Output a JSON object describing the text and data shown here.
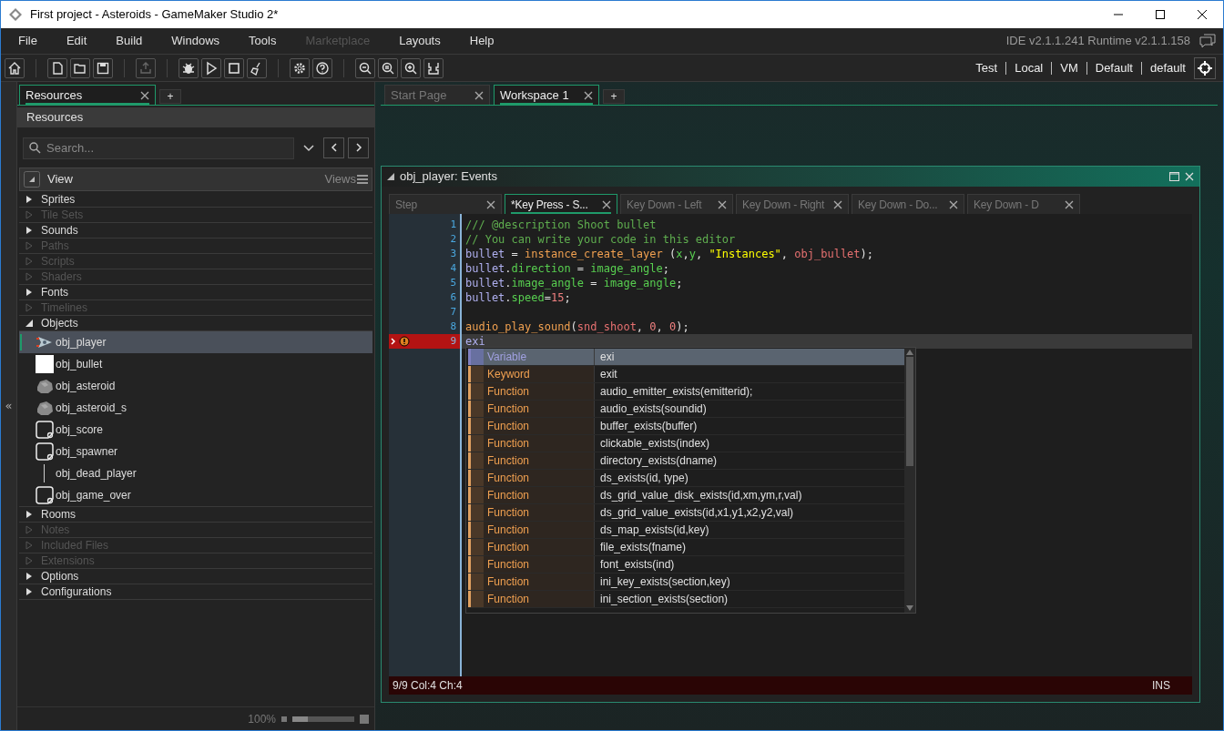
{
  "window": {
    "title": "First project - Asteroids - GameMaker Studio 2*"
  },
  "menu": [
    {
      "label": "File",
      "disabled": false
    },
    {
      "label": "Edit",
      "disabled": false
    },
    {
      "label": "Build",
      "disabled": false
    },
    {
      "label": "Windows",
      "disabled": false
    },
    {
      "label": "Tools",
      "disabled": false
    },
    {
      "label": "Marketplace",
      "disabled": true
    },
    {
      "label": "Layouts",
      "disabled": false
    },
    {
      "label": "Help",
      "disabled": false
    }
  ],
  "version": "IDE v2.1.1.241 Runtime v2.1.1.158",
  "sidebar_toggle": "«",
  "target": [
    "Test",
    "Local",
    "VM",
    "Default",
    "default"
  ],
  "left_panel": {
    "tabs": [
      {
        "label": "Resources",
        "selected": true
      }
    ],
    "add_tab": "+",
    "header": "Resources",
    "search": {
      "placeholder": "Search..."
    },
    "view_label": "View",
    "views_label": "Views",
    "tree": [
      {
        "label": "Sprites",
        "disabled": false,
        "expanded": false
      },
      {
        "label": "Tile Sets",
        "disabled": true,
        "expanded": false
      },
      {
        "label": "Sounds",
        "disabled": false,
        "expanded": false
      },
      {
        "label": "Paths",
        "disabled": true,
        "expanded": false
      },
      {
        "label": "Scripts",
        "disabled": true,
        "expanded": false
      },
      {
        "label": "Shaders",
        "disabled": true,
        "expanded": false
      },
      {
        "label": "Fonts",
        "disabled": false,
        "expanded": false
      },
      {
        "label": "Timelines",
        "disabled": true,
        "expanded": false
      },
      {
        "label": "Objects",
        "disabled": false,
        "expanded": true,
        "children": [
          {
            "label": "obj_player",
            "kind": "ship",
            "selected": true
          },
          {
            "label": "obj_bullet",
            "kind": "square",
            "selected": false
          },
          {
            "label": "obj_asteroid",
            "kind": "rock",
            "selected": false
          },
          {
            "label": "obj_asteroid_s",
            "kind": "rock",
            "selected": false
          },
          {
            "label": "obj_score",
            "kind": "blank",
            "selected": false
          },
          {
            "label": "obj_spawner",
            "kind": "blank",
            "selected": false
          },
          {
            "label": "obj_dead_player",
            "kind": "none",
            "selected": false
          },
          {
            "label": "obj_game_over",
            "kind": "blank",
            "selected": false
          }
        ]
      },
      {
        "label": "Rooms",
        "disabled": false,
        "expanded": false
      },
      {
        "label": "Notes",
        "disabled": true,
        "expanded": false
      },
      {
        "label": "Included Files",
        "disabled": true,
        "expanded": false
      },
      {
        "label": "Extensions",
        "disabled": true,
        "expanded": false
      },
      {
        "label": "Options",
        "disabled": false,
        "expanded": false
      },
      {
        "label": "Configurations",
        "disabled": false,
        "expanded": false
      }
    ],
    "zoom": {
      "reading": "100%",
      "level": 0.25
    }
  },
  "doc_tabs": [
    {
      "label": "Start Page",
      "selected": false
    },
    {
      "label": "Workspace 1",
      "selected": true
    }
  ],
  "add_tab": "+",
  "editor": {
    "title": "obj_player: Events",
    "tabs": [
      {
        "label": "Step",
        "selected": false
      },
      {
        "label": "*Key Press - S...",
        "selected": true
      },
      {
        "label": "Key Down - Left",
        "selected": false
      },
      {
        "label": "Key Down - Right",
        "selected": false
      },
      {
        "label": "Key Down - Do...",
        "selected": false
      },
      {
        "label": "Key Down - D",
        "selected": false
      }
    ],
    "lines": [
      {
        "number": "1",
        "error": false,
        "tokens": [
          {
            "text": "/// @description Shoot bullet",
            "kind": "comment"
          }
        ]
      },
      {
        "number": "2",
        "error": false,
        "tokens": [
          {
            "text": "// You can write your code in this editor",
            "kind": "comment"
          }
        ]
      },
      {
        "number": "3",
        "error": false,
        "tokens": [
          {
            "text": "bullet",
            "kind": "variable"
          },
          {
            "text": " = ",
            "kind": "plain"
          },
          {
            "text": "instance_create_layer",
            "kind": "function"
          },
          {
            "text": " (",
            "kind": "plain"
          },
          {
            "text": "x",
            "kind": "builtin"
          },
          {
            "text": ",",
            "kind": "plain"
          },
          {
            "text": "y",
            "kind": "builtin"
          },
          {
            "text": ", ",
            "kind": "plain"
          },
          {
            "text": "\"Instances\"",
            "kind": "string"
          },
          {
            "text": ", ",
            "kind": "plain"
          },
          {
            "text": "obj_bullet",
            "kind": "asset"
          },
          {
            "text": ");",
            "kind": "plain"
          }
        ]
      },
      {
        "number": "4",
        "error": false,
        "tokens": [
          {
            "text": "bullet",
            "kind": "variable"
          },
          {
            "text": ".",
            "kind": "plain"
          },
          {
            "text": "direction",
            "kind": "builtin"
          },
          {
            "text": " = ",
            "kind": "plain"
          },
          {
            "text": "image_angle",
            "kind": "builtin"
          },
          {
            "text": ";",
            "kind": "plain"
          }
        ]
      },
      {
        "number": "5",
        "error": false,
        "tokens": [
          {
            "text": "bullet",
            "kind": "variable"
          },
          {
            "text": ".",
            "kind": "plain"
          },
          {
            "text": "image_angle",
            "kind": "builtin"
          },
          {
            "text": " = ",
            "kind": "plain"
          },
          {
            "text": "image_angle",
            "kind": "builtin"
          },
          {
            "text": ";",
            "kind": "plain"
          }
        ]
      },
      {
        "number": "6",
        "error": false,
        "tokens": [
          {
            "text": "bullet",
            "kind": "variable"
          },
          {
            "text": ".",
            "kind": "plain"
          },
          {
            "text": "speed",
            "kind": "builtin"
          },
          {
            "text": "=",
            "kind": "plain"
          },
          {
            "text": "15",
            "kind": "number"
          },
          {
            "text": ";",
            "kind": "plain"
          }
        ]
      },
      {
        "number": "7",
        "error": false
      },
      {
        "number": "8",
        "error": false,
        "tokens": [
          {
            "text": "audio_play_sound",
            "kind": "function"
          },
          {
            "text": "(",
            "kind": "plain"
          },
          {
            "text": "snd_shoot",
            "kind": "asset"
          },
          {
            "text": ", ",
            "kind": "plain"
          },
          {
            "text": "0",
            "kind": "number"
          },
          {
            "text": ", ",
            "kind": "plain"
          },
          {
            "text": "0",
            "kind": "number"
          },
          {
            "text": ");",
            "kind": "plain"
          }
        ]
      },
      {
        "number": "9",
        "error": true,
        "tokens": [
          {
            "text": "exi",
            "kind": "variable"
          }
        ]
      }
    ],
    "completions": [
      {
        "type": "Variable",
        "text": "exi",
        "kind": "variable",
        "selected": true
      },
      {
        "type": "Keyword",
        "text": "exit",
        "kind": "keyword",
        "selected": false
      },
      {
        "type": "Function",
        "text": "audio_emitter_exists(emitterid);",
        "kind": "function",
        "selected": false
      },
      {
        "type": "Function",
        "text": "audio_exists(soundid)",
        "kind": "function",
        "selected": false
      },
      {
        "type": "Function",
        "text": "buffer_exists(buffer)",
        "kind": "function",
        "selected": false
      },
      {
        "type": "Function",
        "text": "clickable_exists(index)",
        "kind": "function",
        "selected": false
      },
      {
        "type": "Function",
        "text": "directory_exists(dname)",
        "kind": "function",
        "selected": false
      },
      {
        "type": "Function",
        "text": "ds_exists(id, type)",
        "kind": "function",
        "selected": false
      },
      {
        "type": "Function",
        "text": "ds_grid_value_disk_exists(id,xm,ym,r,val)",
        "kind": "function",
        "selected": false
      },
      {
        "type": "Function",
        "text": "ds_grid_value_exists(id,x1,y1,x2,y2,val)",
        "kind": "function",
        "selected": false
      },
      {
        "type": "Function",
        "text": "ds_map_exists(id,key)",
        "kind": "function",
        "selected": false
      },
      {
        "type": "Function",
        "text": "file_exists(fname)",
        "kind": "function",
        "selected": false
      },
      {
        "type": "Function",
        "text": "font_exists(ind)",
        "kind": "function",
        "selected": false
      },
      {
        "type": "Function",
        "text": "ini_key_exists(section,key)",
        "kind": "function",
        "selected": false
      },
      {
        "type": "Function",
        "text": "ini_section_exists(section)",
        "kind": "function",
        "selected": false
      }
    ],
    "status": {
      "position": "9/9 Col:4 Ch:4",
      "mode": "INS"
    }
  }
}
